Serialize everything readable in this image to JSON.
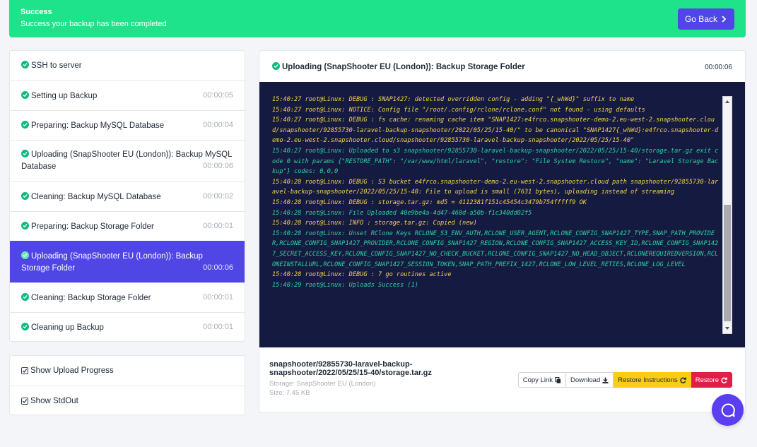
{
  "banner": {
    "title": "Success",
    "message": "Success your backup has been completed",
    "go_back_label": "Go Back",
    "color": "#1ee38a"
  },
  "steps": [
    {
      "label": "SSH to server",
      "time": ""
    },
    {
      "label": "Setting up Backup",
      "time": "00:00:05"
    },
    {
      "label": "Preparing: Backup MySQL Database",
      "time": "00:00:04"
    },
    {
      "label": "Uploading (SnapShooter EU (London)): Backup MySQL Database",
      "time": "00:00:06"
    },
    {
      "label": "Cleaning: Backup MySQL Database",
      "time": "00:00:02"
    },
    {
      "label": "Preparing: Backup Storage Folder",
      "time": "00:00:01"
    },
    {
      "label": "Uploading (SnapShooter EU (London)): Backup Storage Folder",
      "time": "00:00:06",
      "active": true
    },
    {
      "label": "Cleaning: Backup Storage Folder",
      "time": "00:00:01"
    },
    {
      "label": "Cleaning up Backup",
      "time": "00:00:01"
    }
  ],
  "options": {
    "show_upload_progress": "Show Upload Progress",
    "show_stdout": "Show StdOut"
  },
  "detail": {
    "title": "Uploading (SnapShooter EU (London)): Backup Storage Folder",
    "time": "00:00:06"
  },
  "log_lines": [
    {
      "color": "yellow",
      "text": "15:40:27 root@Linux: DEBUG : SNAP1427: detected overridden config - adding \"{_whWd}\" suffix to name"
    },
    {
      "color": "yellow",
      "text": "15:40:27 root@Linux: NOTICE: Config file \"/root/.config/rclone/rclone.conf\" not found - using defaults"
    },
    {
      "color": "yellow",
      "text": "15:40:27 root@Linux: DEBUG : fs cache: renaming cache item \"SNAP1427:e4frco.snapshooter-demo-2.eu-west-2.snapshooter.cloud/snapshooter/92855730-laravel-backup-snapshooter/2022/05/25/15-40/\" to be canonical \"SNAP1427{_whWd}:e4frco.snapshooter-demo-2.eu-west-2.snapshooter.cloud/snapshooter/92855730-laravel-backup-snapshooter/2022/05/25/15-40\""
    },
    {
      "color": "green",
      "text": "15:40:27 root@Linux: Uploaded to s3 snapshooter/92855730-laravel-backup-snapshooter/2022/05/25/15-40/storage.tar.gz exit code 0 with params {\"RESTORE_PATH\": \"/var/www/html/laravel\", \"restore\": \"File System Restore\", \"name\": \"Laravel Storage Backup\"} codes: 0,0,0"
    },
    {
      "color": "yellow",
      "text": "15:40:28 root@Linux: DEBUG : S3 bucket e4frco.snapshooter-demo-2.eu-west-2.snapshooter.cloud path snapshooter/92855730-laravel-backup-snapshooter/2022/05/25/15-40: File to upload is small (7631 bytes), uploading instead of streaming"
    },
    {
      "color": "yellow",
      "text": "15:40:28 root@Linux: DEBUG : storage.tar.gz: md5 = 4112381f151c45454c3479b754fffff9 OK"
    },
    {
      "color": "green",
      "text": "15:40:28 root@Linux: File Uploaded 40e9be4a-4d47-460d-a50b-f1c340dd02f5"
    },
    {
      "color": "yellow",
      "text": "15:40:28 root@Linux: INFO : storage.tar.gz: Copied (new)"
    },
    {
      "color": "green",
      "text": "15:40:28 root@Linux: Unset RClone Keys RCLONE_S3_ENV_AUTH,RCLONE_USER_AGENT,RCLONE_CONFIG_SNAP1427_TYPE,SNAP_PATH_PROVIDER,RCLONE_CONFIG_SNAP1427_PROVIDER,RCLONE_CONFIG_SNAP1427_REGION,RCLONE_CONFIG_SNAP1427_ACCESS_KEY_ID,RCLONE_CONFIG_SNAP1427_SECRET_ACCESS_KEY,RCLONE_CONFIG_SNAP1427_NO_CHECK_BUCKET,RCLONE_CONFIG_SNAP1427_NO_HEAD_OBJECT,RCLONEREQUIREDVERSION,RCLONEINSTALLURL,RCLONE_CONFIG_SNAP1427_SESSION_TOKEN,SNAP_PATH_PREFIX_1427,RCLONE_LOW_LEVEL_RETIES,RCLONE_LOG_LEVEL"
    },
    {
      "color": "yellow",
      "text": "15:40:28 root@Linux: DEBUG : 7 go routines active"
    },
    {
      "color": "green",
      "text": "15:40:29 root@Linux: Uploads Success (1)"
    }
  ],
  "file": {
    "path": "snapshooter/92855730-laravel-backup-snapshooter/2022/05/25/15-40/storage.tar.gz",
    "storage": "Storage: SnapShooter EU (London)",
    "size": "Size: 7.45 KB"
  },
  "actions": {
    "copy_link": "Copy Link",
    "download": "Download",
    "restore_instructions": "Restore Instructions",
    "restore": "Restore"
  },
  "colors": {
    "accent": "#4f46e5",
    "success": "#10b981",
    "console_bg": "#151a40",
    "log_yellow": "#f6d54a",
    "log_green": "#2fd3a1",
    "warn": "#facc15",
    "danger": "#e11d48"
  },
  "icons": {
    "go_back": "chevron-right-icon",
    "step_status": "check-circle-icon",
    "option_checkbox": "checked-box-icon",
    "copy": "copy-icon",
    "download": "download-icon",
    "restore": "refresh-icon",
    "chat": "chat-bubble-icon"
  }
}
